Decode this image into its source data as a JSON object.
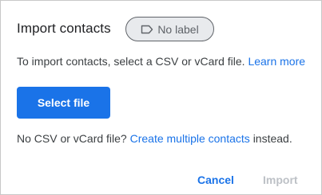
{
  "dialog": {
    "title": "Import contacts",
    "label_chip": {
      "icon": "label-outline-icon",
      "text": "No label"
    },
    "instructions": {
      "text": "To import contacts, select a CSV or vCard file.",
      "link": "Learn more"
    },
    "select_button": "Select file",
    "no_file": {
      "prefix": "No CSV or vCard file?",
      "link": "Create multiple contacts",
      "suffix": "instead."
    },
    "actions": {
      "cancel": "Cancel",
      "import": "Import",
      "import_enabled": false
    }
  },
  "colors": {
    "accent": "#1a73e8",
    "text": "#3c4043",
    "disabled": "#bdc1c6",
    "chip_bg": "#e8eaed"
  }
}
